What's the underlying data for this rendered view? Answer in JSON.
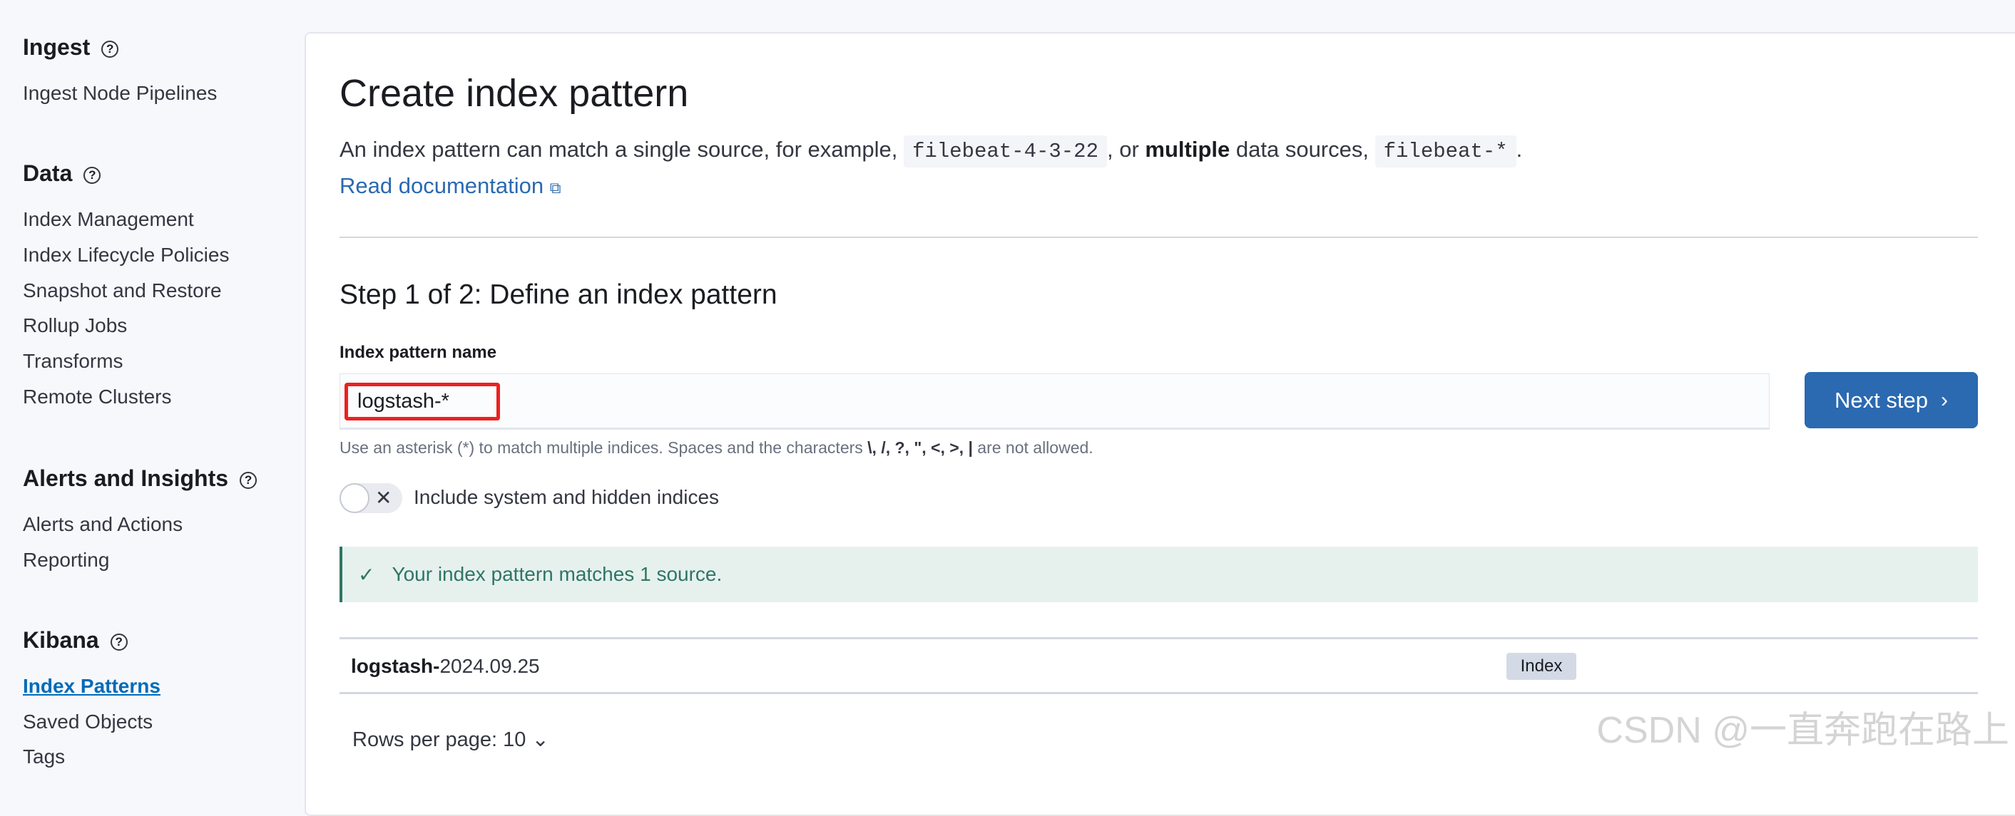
{
  "sidebar": {
    "sections": [
      {
        "title": "Ingest",
        "items": [
          "Ingest Node Pipelines"
        ]
      },
      {
        "title": "Data",
        "items": [
          "Index Management",
          "Index Lifecycle Policies",
          "Snapshot and Restore",
          "Rollup Jobs",
          "Transforms",
          "Remote Clusters"
        ]
      },
      {
        "title": "Alerts and Insights",
        "items": [
          "Alerts and Actions",
          "Reporting"
        ]
      },
      {
        "title": "Kibana",
        "items": [
          "Index Patterns",
          "Saved Objects",
          "Tags"
        ]
      }
    ],
    "active_item": "Index Patterns",
    "help_icon": "question-circle-icon"
  },
  "main": {
    "title": "Create index pattern",
    "desc_pre": "An index pattern can match a single source, for example,",
    "desc_code1": "filebeat-4-3-22",
    "desc_mid": ", or",
    "desc_bold": "multiple",
    "desc_post": "data sources,",
    "desc_code2": "filebeat-*",
    "desc_end": ".",
    "doc_link": "Read documentation",
    "step_title": "Step 1 of 2: Define an index pattern",
    "field_label": "Index pattern name",
    "field_value": "logstash-*",
    "next_button": "Next step",
    "help_pre": "Use an asterisk (*) to match multiple indices. Spaces and the characters",
    "help_chars": "\\, /, ?, \", <, >, |",
    "help_post": "are not allowed.",
    "toggle_label": "Include system and hidden indices",
    "toggle_on": false,
    "callout": "Your index pattern matches 1 source.",
    "callout_color": "#2f7564",
    "rows": [
      {
        "name_bold": "logstash-",
        "name_rest": "2024.09.25",
        "type": "Index"
      }
    ],
    "rows_per_page": "Rows per page: 10",
    "accent": "#2b69b1"
  },
  "watermark": "CSDN @一直奔跑在路上"
}
